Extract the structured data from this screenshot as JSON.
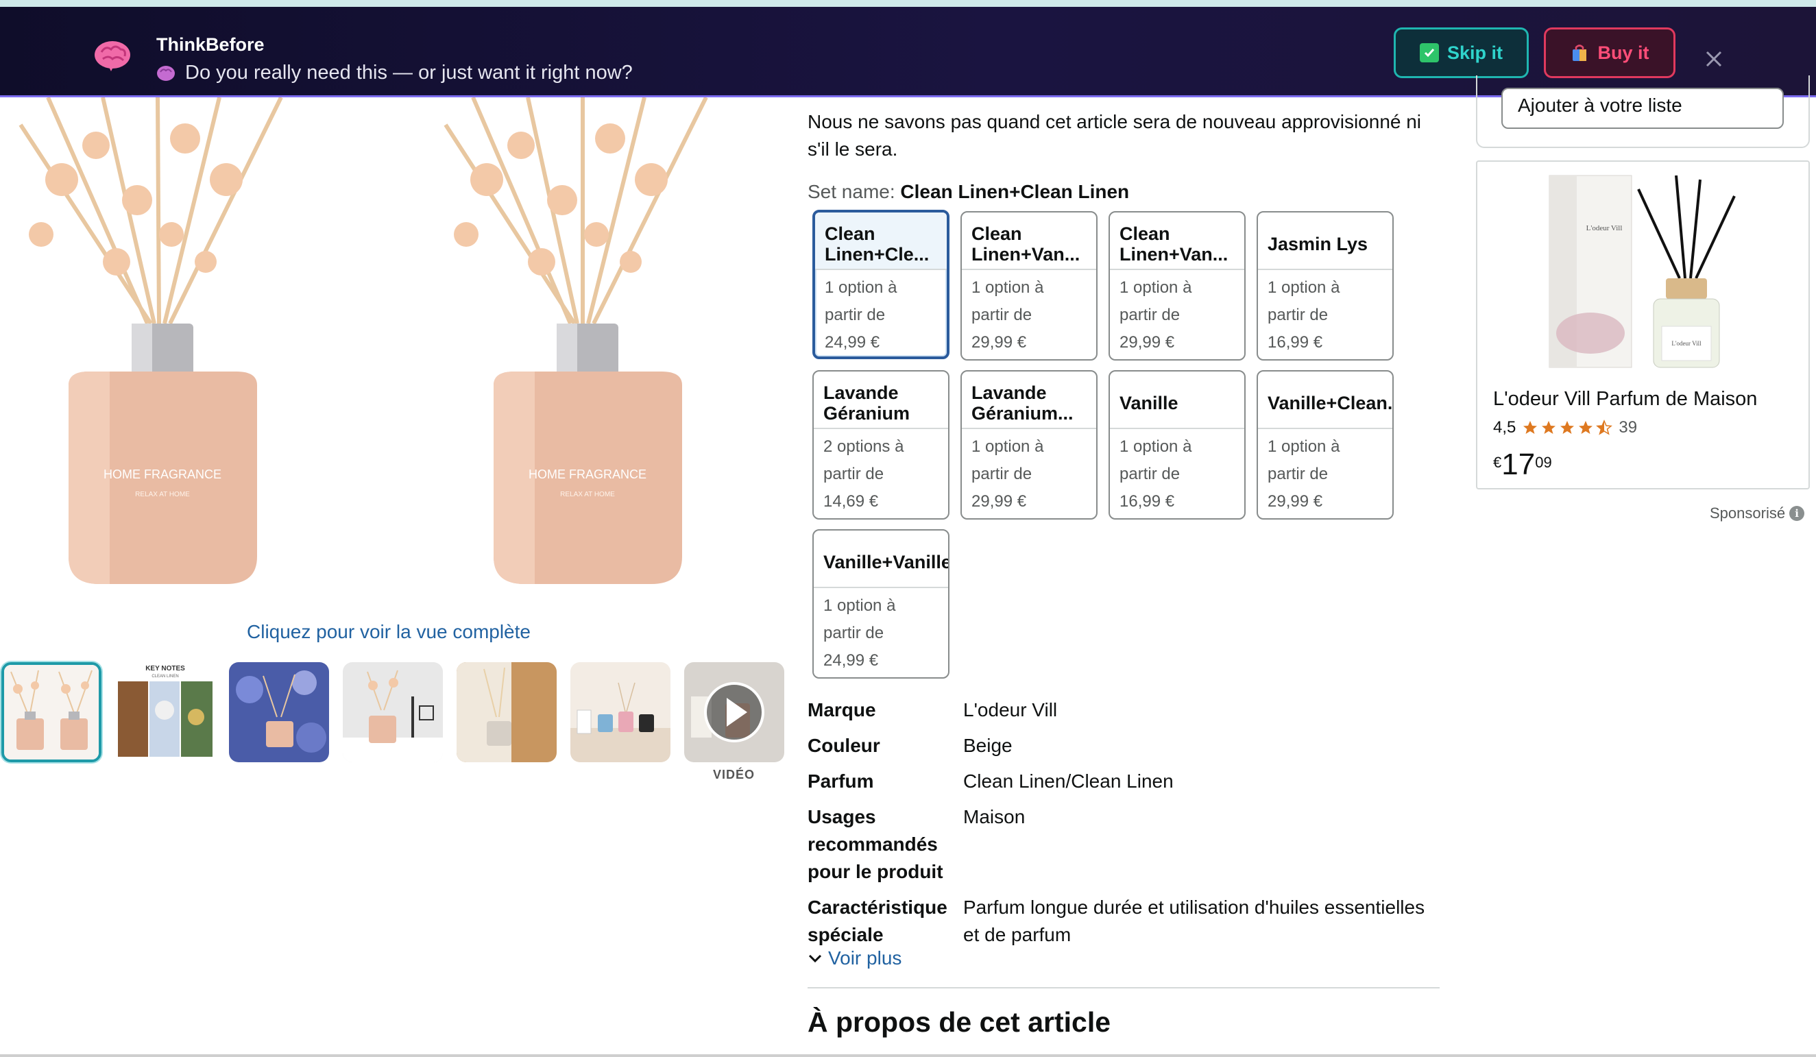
{
  "banner": {
    "app_name": "ThinkBefore",
    "question": "Do you really need this — or just want it right now?",
    "skip_label": "Skip it",
    "buy_label": "Buy it"
  },
  "gallery": {
    "main_image_text": "HOME FRAGRANCE",
    "main_image_subtext": "RELAX AT HOME",
    "full_view_link": "Cliquez pour voir la vue complète",
    "thumb2_label": "KEY NOTES",
    "thumb2_sublabel": "CLEAN LINEN",
    "video_label": "VIDÉO"
  },
  "product": {
    "stock_text": "Nous ne savons pas quand cet article sera de nouveau approvisionné ni s'il le sera.",
    "set_name_label": "Set name:",
    "set_name_value": "Clean Linen+Clean Linen",
    "options": [
      {
        "title": "Clean Linen+Cle...",
        "line1": "1 option à",
        "line2": "partir de",
        "price": "24,99 €"
      },
      {
        "title": "Clean Linen+Van...",
        "line1": "1 option à",
        "line2": "partir de",
        "price": "29,99 €"
      },
      {
        "title": "Clean Linen+Van...",
        "line1": "1 option à",
        "line2": "partir de",
        "price": "29,99 €"
      },
      {
        "title": "Jasmin Lys",
        "line1": "1 option à",
        "line2": "partir de",
        "price": "16,99 €"
      },
      {
        "title": "Lavande Géranium",
        "line1": "2 options à",
        "line2": "partir de",
        "price": "14,69 €"
      },
      {
        "title": "Lavande Géranium...",
        "line1": "1 option à",
        "line2": "partir de",
        "price": "29,99 €"
      },
      {
        "title": "Vanille",
        "line1": "1 option à",
        "line2": "partir de",
        "price": "16,99 €"
      },
      {
        "title": "Vanille+Clean...",
        "line1": "1 option à",
        "line2": "partir de",
        "price": "29,99 €"
      },
      {
        "title": "Vanille+Vanille",
        "line1": "1 option à",
        "line2": "partir de",
        "price": "24,99 €"
      }
    ],
    "specs": [
      {
        "key": "Marque",
        "value": "L'odeur Vill"
      },
      {
        "key": "Couleur",
        "value": "Beige"
      },
      {
        "key": "Parfum",
        "value": "Clean Linen/Clean Linen"
      },
      {
        "key": "Usages recommandés pour le produit",
        "value": "Maison"
      },
      {
        "key": "Caractéristique spéciale",
        "value": "Parfum longue durée et utilisation d'huiles essentielles et de parfum"
      }
    ],
    "voir_plus": "Voir plus",
    "about_title": "À propos de cet article"
  },
  "sidebar": {
    "list_button": "Ajouter à votre liste",
    "ad": {
      "box_brand": "L'odeur Vill",
      "title": "L'odeur Vill Parfum de Maison",
      "rating": "4,5",
      "review_count": "39",
      "price_currency": "€",
      "price_whole": "17",
      "price_fraction": "09",
      "stars": 4.5
    },
    "sponsored": "Sponsorisé"
  },
  "colors": {
    "banner_bg": "#1a1440",
    "skip_accent": "#1fb6b0",
    "buy_accent": "#e0395e",
    "link": "#2162a1",
    "star": "#de7921"
  }
}
